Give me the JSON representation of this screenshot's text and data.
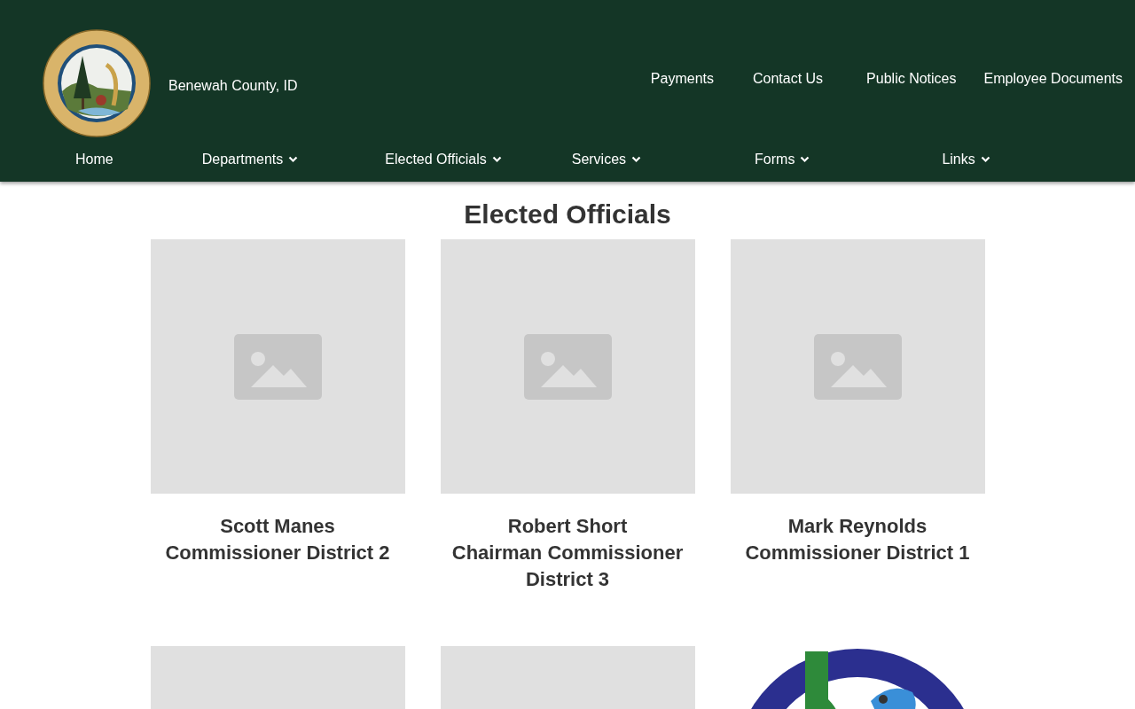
{
  "site": {
    "name": "Benewah County, ID"
  },
  "top_links": [
    "Payments",
    "Contact Us",
    "Public Notices",
    "Employee Documents"
  ],
  "nav": [
    {
      "label": "Home",
      "dropdown": false
    },
    {
      "label": "Departments",
      "dropdown": true
    },
    {
      "label": "Elected Officials",
      "dropdown": true
    },
    {
      "label": "Services",
      "dropdown": true
    },
    {
      "label": "Forms",
      "dropdown": true
    },
    {
      "label": "Links",
      "dropdown": true
    }
  ],
  "heading": "Elected Officials",
  "officials": [
    {
      "kind": "placeholder",
      "name": "Scott Manes",
      "title": "Commissioner District 2"
    },
    {
      "kind": "placeholder",
      "name": "Robert Short",
      "title": "Chairman Commissioner District 3"
    },
    {
      "kind": "placeholder",
      "name": "Mark Reynolds",
      "title": "Commissioner District 1"
    },
    {
      "kind": "blank"
    },
    {
      "kind": "blank"
    },
    {
      "kind": "logo"
    }
  ]
}
